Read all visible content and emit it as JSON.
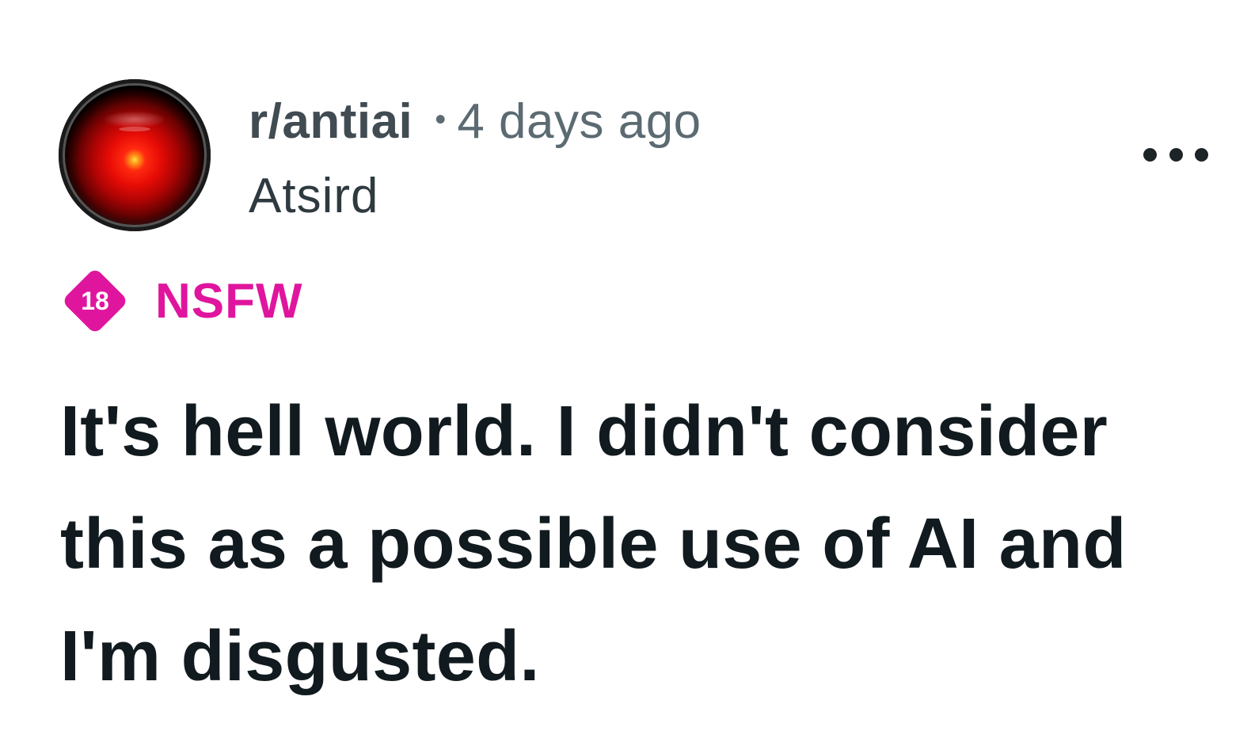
{
  "post": {
    "subreddit": "r/antiai",
    "separator": "•",
    "time_ago": "4 days ago",
    "author": "Atsird",
    "avatar_icon": "hal-9000-red-eye-icon",
    "more_icon": "more-options-ellipsis-icon",
    "nsfw": {
      "badge_number": "18",
      "label": "NSFW",
      "color": "#e0159e"
    },
    "title": "It's hell world. I didn't consider this as a possible use of AI and I'm disgusted."
  },
  "colors": {
    "background": "#ffffff",
    "title_text": "#111a1e",
    "meta_text": "#5c6a72",
    "accent_nsfw": "#e0159e"
  }
}
